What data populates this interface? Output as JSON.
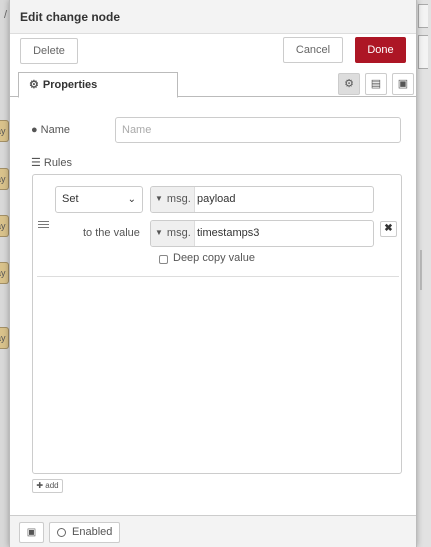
{
  "background": {
    "node_label": "ay"
  },
  "tray": {
    "title": "Edit change node",
    "delete_label": "Delete",
    "cancel_label": "Cancel",
    "done_label": "Done",
    "accent_color": "#ad1625"
  },
  "tabs": {
    "properties_label": "Properties",
    "properties_icon": "gear-icon",
    "extra_buttons": [
      "gear-icon",
      "description-icon",
      "appearance-icon"
    ]
  },
  "form": {
    "name_label": "Name",
    "name_placeholder": "Name",
    "name_value": "",
    "rules_label": "Rules"
  },
  "rule": {
    "action": "Set",
    "target_type": "msg.",
    "target_value": "payload",
    "to_label": "to the value",
    "source_type": "msg.",
    "source_value": "timestamps3",
    "deep_copy_label": "Deep copy value",
    "deep_copy_checked": false
  },
  "add_label": "add",
  "footer": {
    "enabled_label": "Enabled"
  }
}
